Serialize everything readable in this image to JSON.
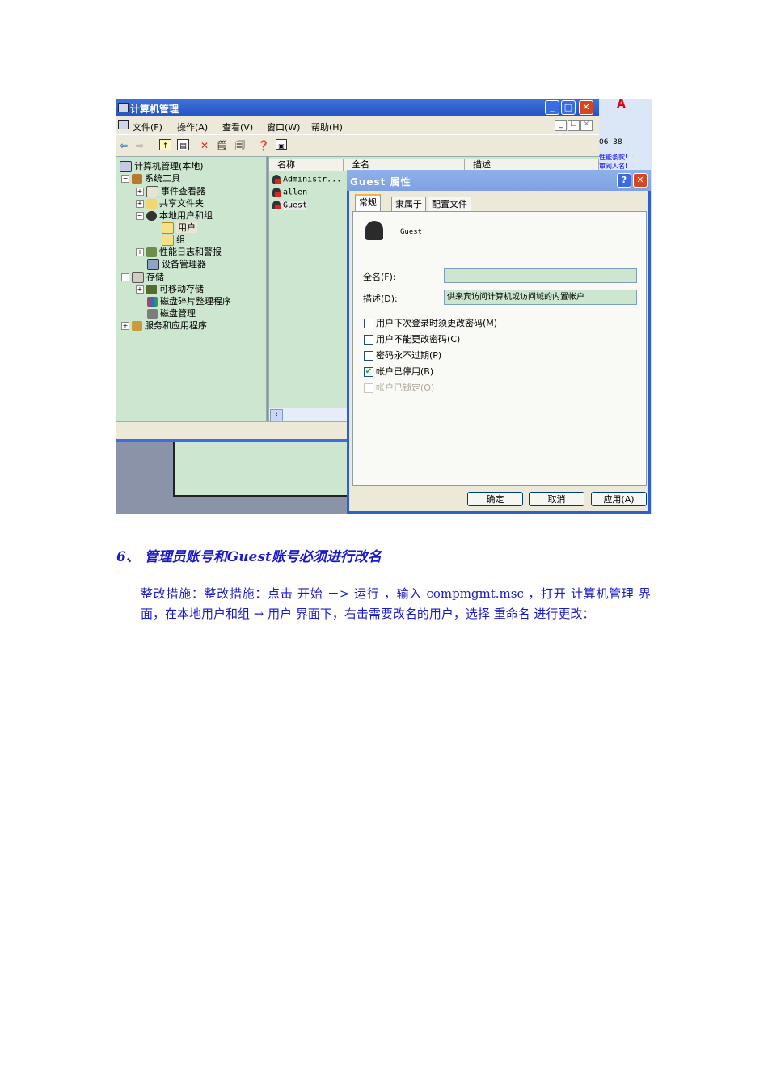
{
  "screenshot": {
    "window_title": "计算机管理",
    "menu": [
      "文件(F)",
      "操作(A)",
      "查看(V)",
      "窗口(W)",
      "帮助(H)"
    ],
    "tree": {
      "root": "计算机管理(本地)",
      "system_tools": "系统工具",
      "event_viewer": "事件查看器",
      "shared_folders": "共享文件夹",
      "local_users_groups": "本地用户和组",
      "users": "用户",
      "groups": "组",
      "perf_logs": "性能日志和警报",
      "device_manager": "设备管理器",
      "storage": "存储",
      "removable_storage": "可移动存储",
      "defrag": "磁盘碎片整理程序",
      "disk_mgmt": "磁盘管理",
      "services_apps": "服务和应用程序"
    },
    "list_headers": [
      "名称",
      "全名",
      "描述"
    ],
    "users": [
      "Administr...",
      "allen",
      "Guest"
    ],
    "right_strip": {
      "nums": "06  38",
      "line1": "性能条款!",
      "line2": "审阅人名!"
    },
    "dialog": {
      "title": "Guest 属性",
      "tabs": [
        "常规",
        "隶属于",
        "配置文件"
      ],
      "user_name": "Guest",
      "fullname_label": "全名(F):",
      "fullname_value": "",
      "desc_label": "描述(D):",
      "desc_value": "供来宾访问计算机或访问域的内置帐户",
      "checkboxes": [
        {
          "label": "用户下次登录时须更改密码(M)",
          "checked": false,
          "enabled": true
        },
        {
          "label": "用户不能更改密码(C)",
          "checked": false,
          "enabled": true
        },
        {
          "label": "密码永不过期(P)",
          "checked": false,
          "enabled": true
        },
        {
          "label": "帐户已停用(B)",
          "checked": true,
          "enabled": true
        },
        {
          "label": "帐户已锁定(O)",
          "checked": false,
          "enabled": false
        }
      ],
      "buttons": [
        "确定",
        "取消",
        "应用(A)"
      ]
    }
  },
  "heading": "6、 管理员账号和Guest账号必须进行改名",
  "paragraph": "整改措施：整改措施：点击 开始 －> 运行 ，输入 compmgmt.msc ，打开 计算机管理 界面，在本地用户和组 → 用户 界面下，右击需要改名的用户，选择 重命名 进行更改："
}
